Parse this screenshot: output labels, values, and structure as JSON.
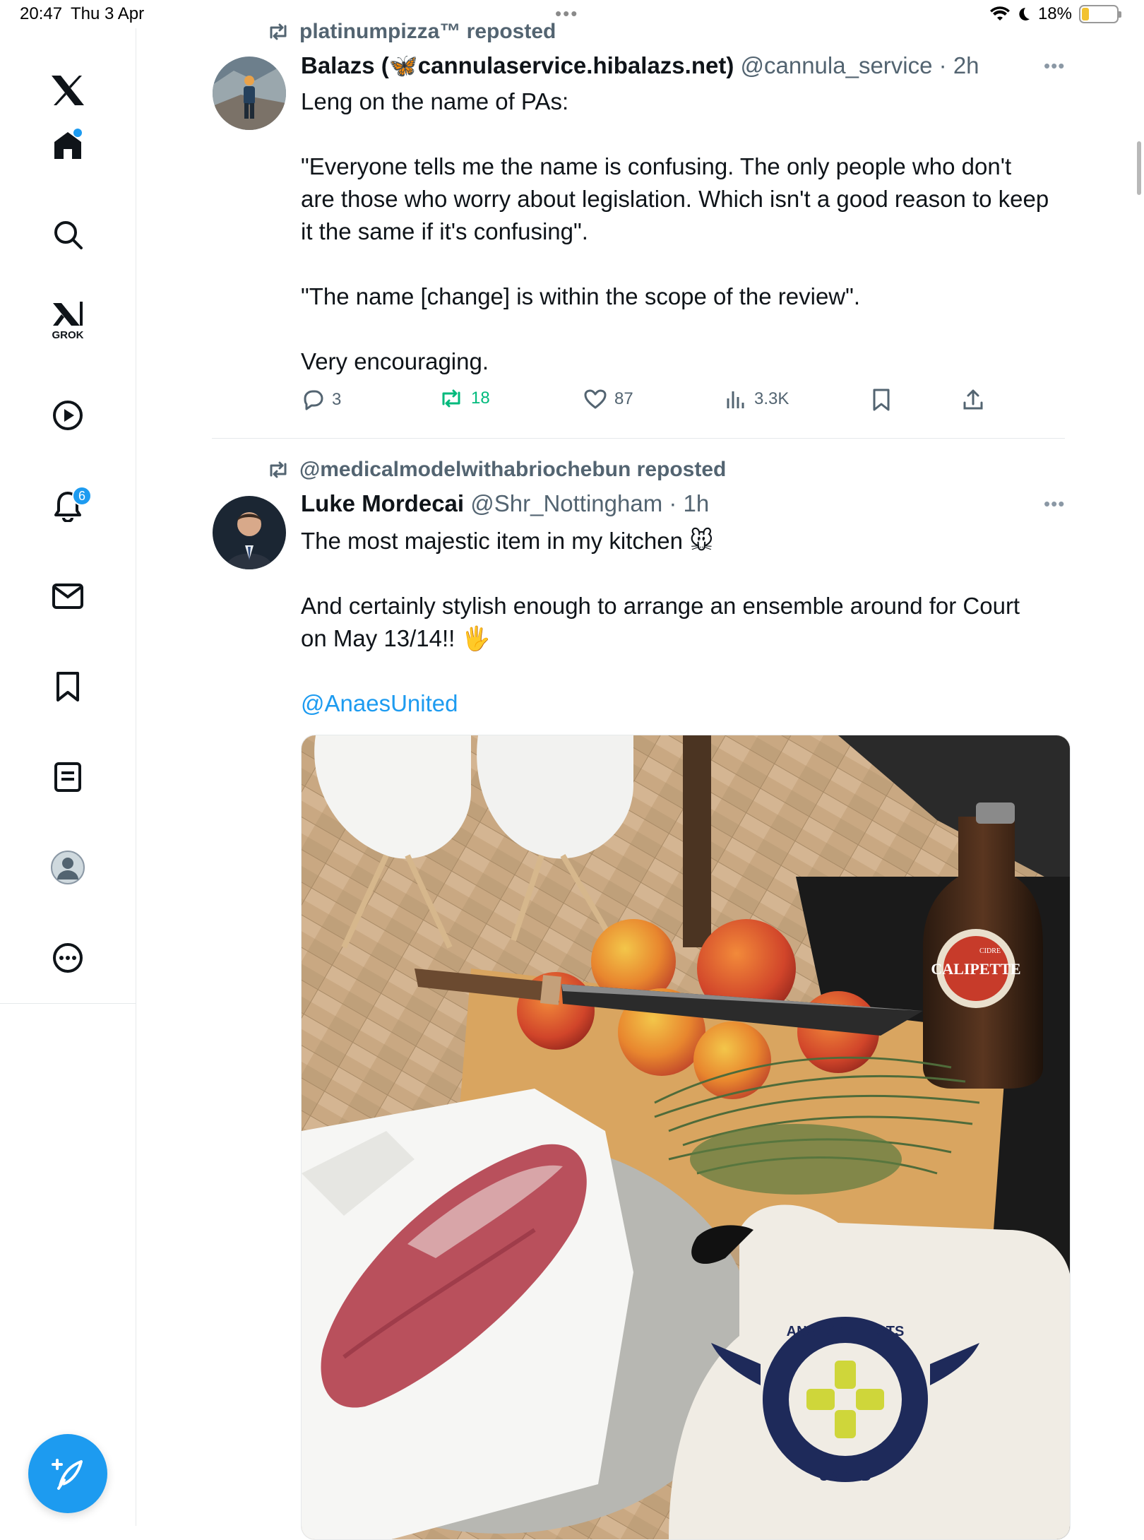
{
  "status_bar": {
    "time": "20:47",
    "date": "Thu 3 Apr",
    "battery": "18%",
    "battery_level": 0.18
  },
  "sidebar": {
    "grok_label": "GROK",
    "notifications_count": "6"
  },
  "tweets": [
    {
      "reposted_by": "platinumpizza™ reposted",
      "name": "Balazs (🦋cannulaservice.hibalazs.net)",
      "handle": "@cannula_service",
      "time": "· 2h",
      "text": "Leng on the name of PAs:\n\n\"Everyone tells me the name is confusing. The only people who don't are those who worry about legislation. Which isn't a good reason to keep it the same if it's confusing\".\n\n\"The name [change] is within the scope of the review\".\n\nVery encouraging.",
      "replies": "3",
      "reposts": "18",
      "likes": "87",
      "views": "3.3K"
    },
    {
      "reposted_by": "@medicalmodelwithabriochebun reposted",
      "name": "Luke Mordecai",
      "handle": "@Shr_Nottingham",
      "time": "· 1h",
      "text_line1": "The most majestic item in my kitchen 🐭",
      "text_line2": "And certainly stylish enough to arrange an ensemble around for Court on May 13/14!! 🖐",
      "mention": "@AnaesUnited"
    }
  ],
  "image": {
    "bottle_brand": "CALIPETTE",
    "bottle_sub": "CIDRE",
    "glove_top": "ANAESTHETISTS",
    "glove_bottom": "UNITED"
  },
  "colors": {
    "accent": "#1d9bf0",
    "repost_green": "#00ba7c",
    "muted": "#536471"
  }
}
